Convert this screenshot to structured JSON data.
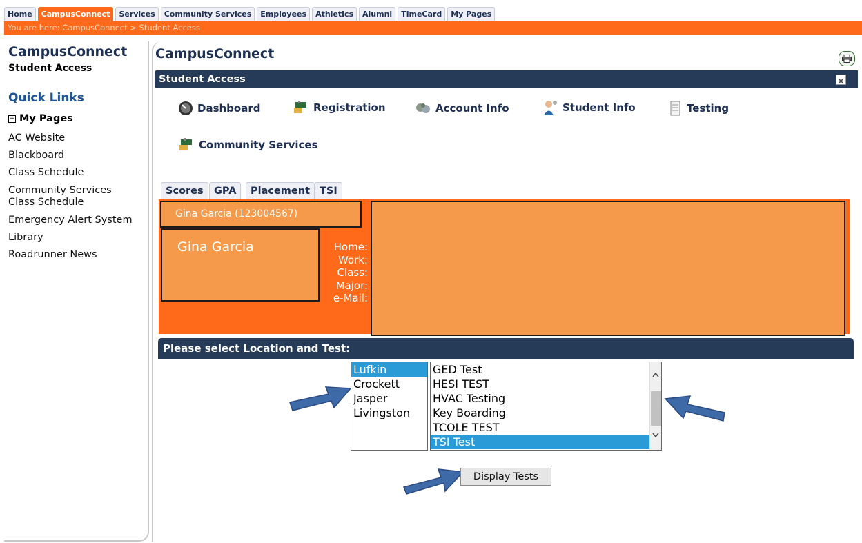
{
  "topnav": {
    "tabs": [
      {
        "label": "Home",
        "active": false
      },
      {
        "label": "CampusConnect",
        "active": true
      },
      {
        "label": "Services",
        "active": false
      },
      {
        "label": "Community Services",
        "active": false
      },
      {
        "label": "Employees",
        "active": false
      },
      {
        "label": "Athletics",
        "active": false
      },
      {
        "label": "Alumni",
        "active": false
      },
      {
        "label": "TimeCard",
        "active": false
      },
      {
        "label": "My Pages",
        "active": false
      }
    ],
    "breadcrumb": "You are here:  CampusConnect > Student Access"
  },
  "sidebar": {
    "title": "CampusConnect",
    "subtitle": "Student Access",
    "quick_links_heading": "Quick Links",
    "my_pages": "My Pages",
    "links": [
      "AC Website",
      "Blackboard",
      "Class Schedule",
      "Community Services Class Schedule",
      "Emergency Alert System",
      "Library",
      "Roadrunner News"
    ]
  },
  "main": {
    "title": "CampusConnect",
    "section_bar": "Student Access",
    "menu": [
      "Dashboard",
      "Registration",
      "Account Info",
      "Student Info",
      "Testing",
      "Community Services"
    ],
    "tabs": [
      "Scores",
      "GPA",
      "Placement",
      "TSI"
    ],
    "student": {
      "name_id": "Gina Garcia  (123004567)",
      "name": "Gina Garcia",
      "labels": [
        "Home:",
        "Work:",
        "Class:",
        "Major:",
        "e-Mail:"
      ]
    },
    "select_bar": "Please select Location and Test:",
    "locations": [
      "Lufkin",
      "Crockett",
      "Jasper",
      "Livingston"
    ],
    "selected_location": "Lufkin",
    "tests": [
      "GED Test",
      "HESI TEST",
      "HVAC Testing",
      "Key Boarding",
      "TCOLE TEST",
      "TSI Test"
    ],
    "selected_test": "TSI Test",
    "display_button": "Display Tests"
  },
  "colors": {
    "accent_orange": "#ff6a1a",
    "light_orange": "#f59a4a",
    "navy": "#253b57",
    "selection_blue": "#2b9bd8",
    "arrow_blue": "#3f6aa8"
  }
}
